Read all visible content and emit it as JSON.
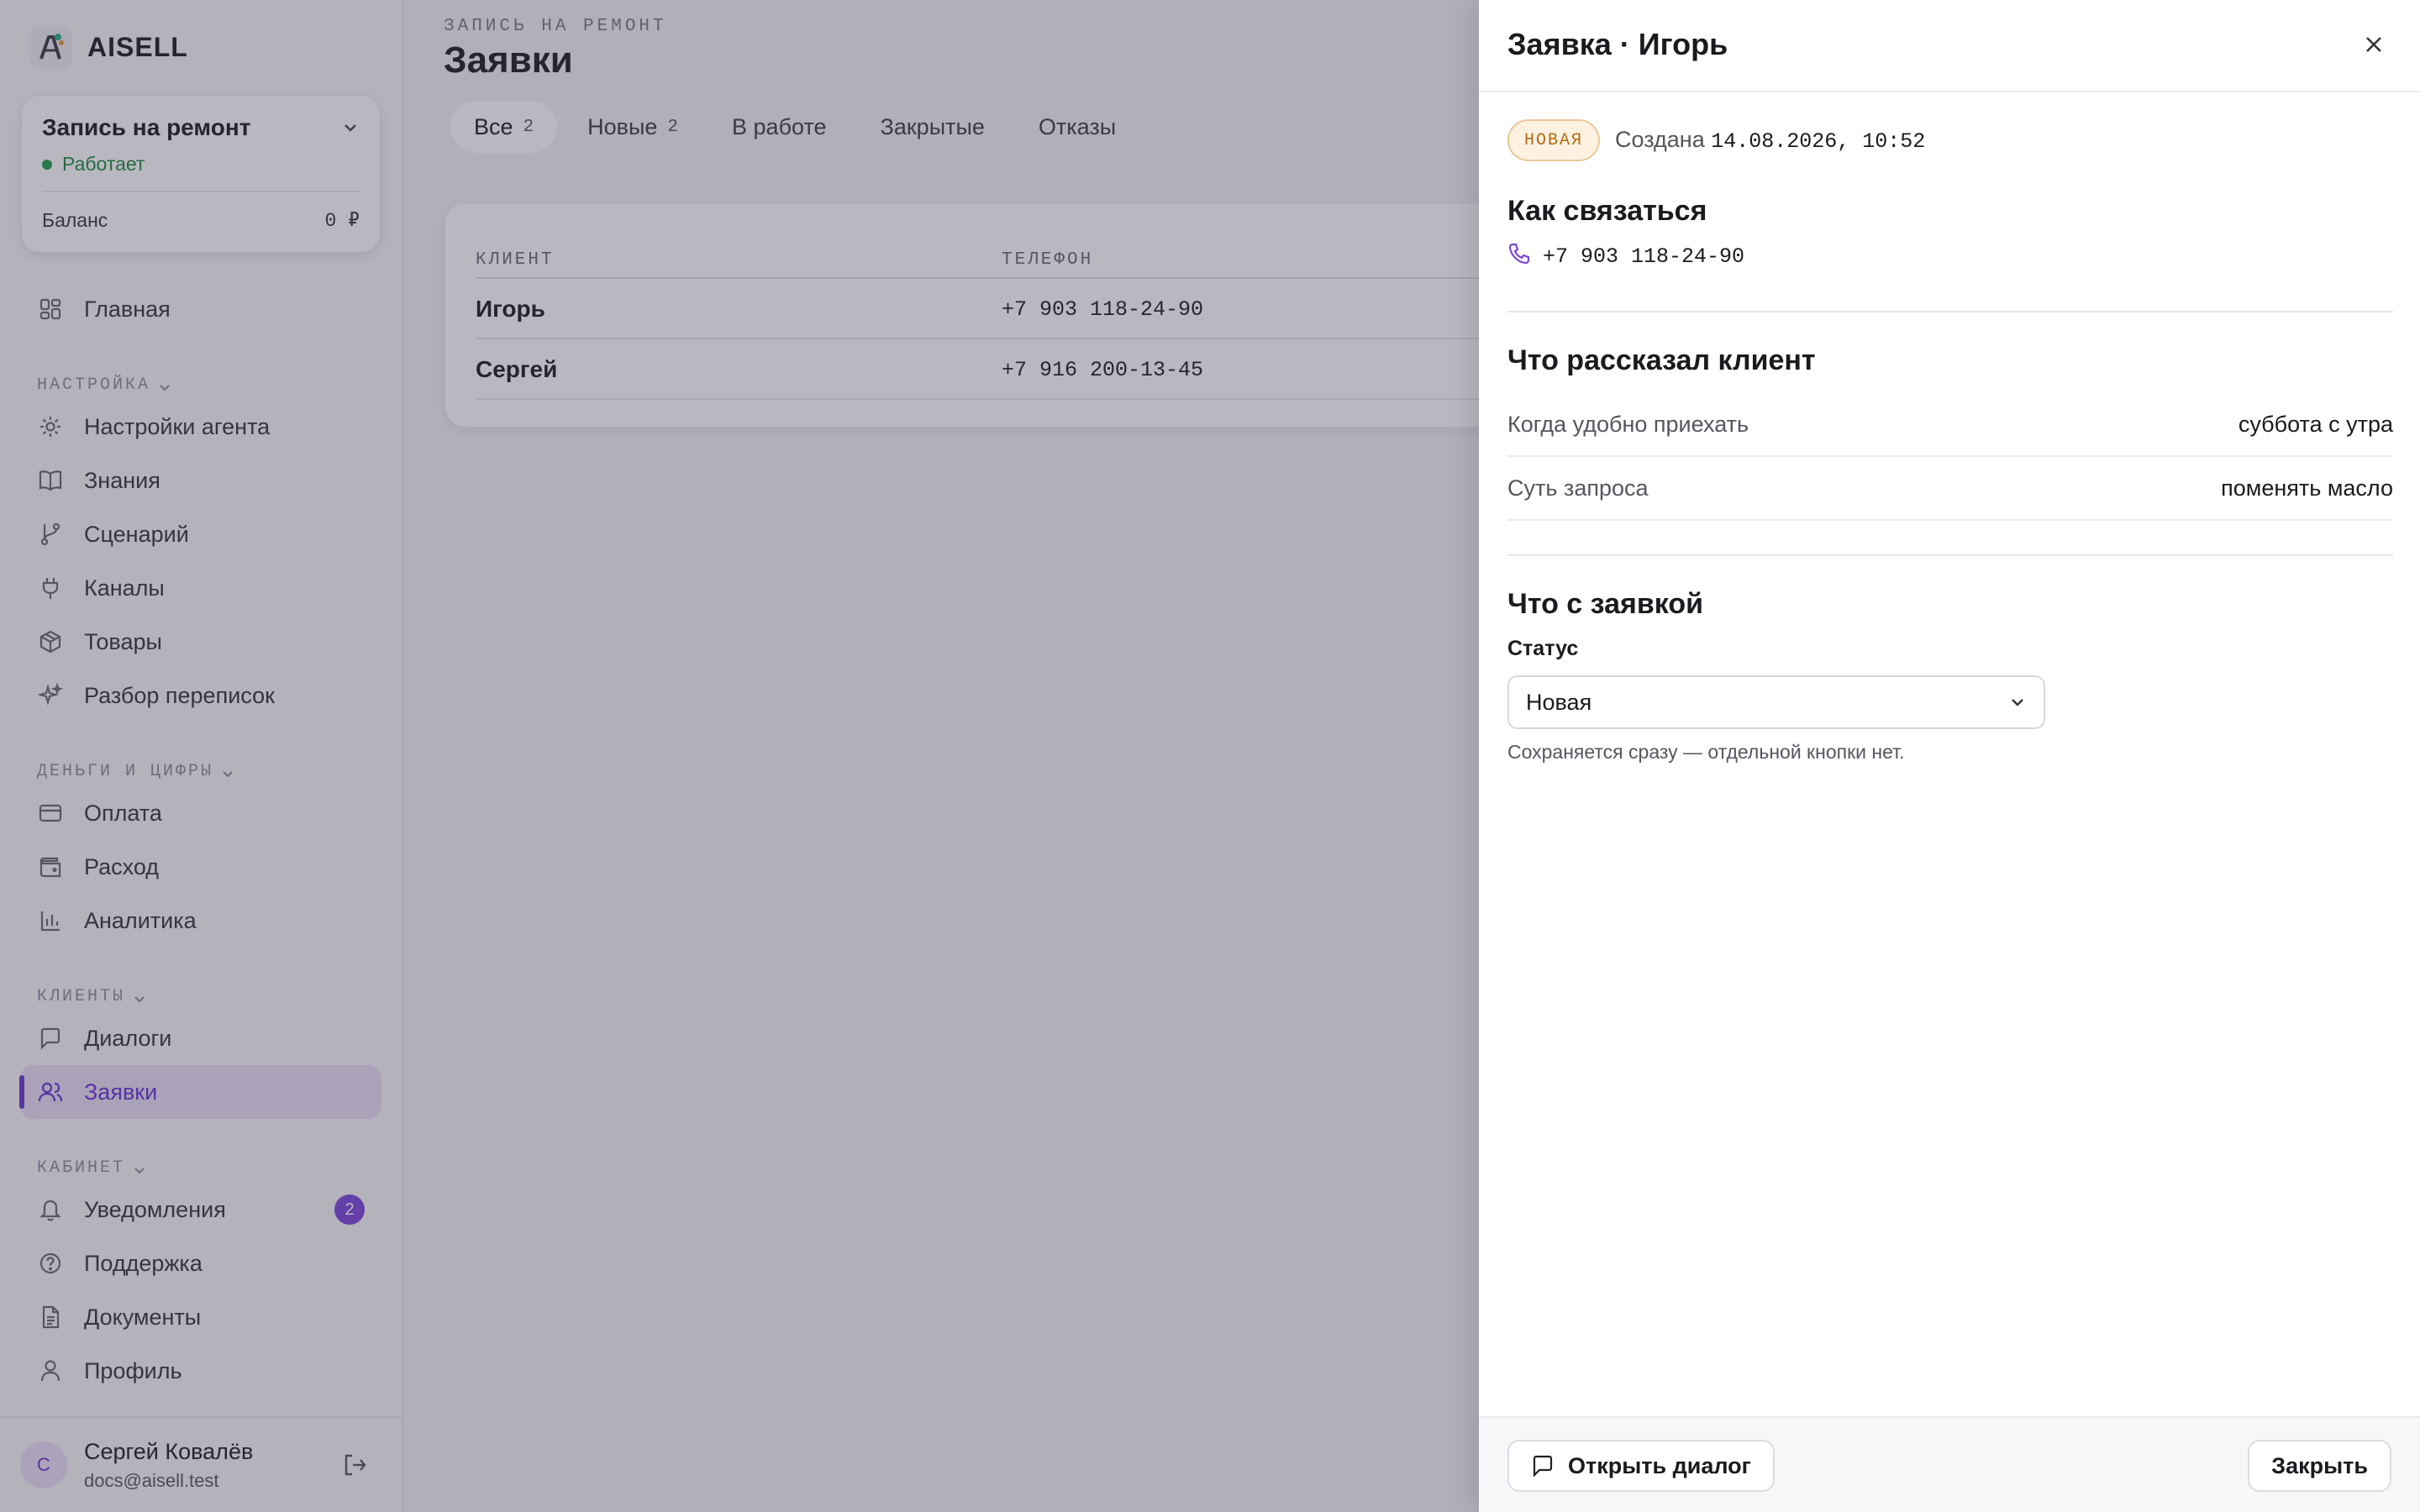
{
  "brand": {
    "name": "AISELL"
  },
  "agent": {
    "title": "Запись на ремонт",
    "status": "Работает",
    "balance_label": "Баланс",
    "balance_value": "0 ₽"
  },
  "nav": {
    "home": "Главная",
    "section_settings": "НАСТРОЙКА",
    "agent_settings": "Настройки агента",
    "knowledge": "Знания",
    "scenario": "Сценарий",
    "channels": "Каналы",
    "products": "Товары",
    "chat_review": "Разбор переписок",
    "section_money": "ДЕНЬГИ И ЦИФРЫ",
    "payment": "Оплата",
    "expense": "Расход",
    "analytics": "Аналитика",
    "section_clients": "КЛИЕНТЫ",
    "dialogs": "Диалоги",
    "requests": "Заявки",
    "section_cabinet": "КАБИНЕТ",
    "notifications": "Уведомления",
    "notifications_count": "2",
    "support": "Поддержка",
    "documents": "Документы",
    "profile": "Профиль"
  },
  "user": {
    "initial": "С",
    "name": "Сергей Ковалёв",
    "email": "docs@aisell.test"
  },
  "page": {
    "eyebrow": "ЗАПИСЬ НА РЕМОНТ",
    "title": "Заявки"
  },
  "tabs": [
    {
      "label": "Все",
      "count": "2"
    },
    {
      "label": "Новые",
      "count": "2"
    },
    {
      "label": "В работе"
    },
    {
      "label": "Закрытые"
    },
    {
      "label": "Отказы"
    }
  ],
  "table": {
    "col_client": "КЛИЕНТ",
    "col_phone": "ТЕЛЕФОН",
    "rows": [
      {
        "name": "Игорь",
        "phone": "+7 903 118-24-90"
      },
      {
        "name": "Сергей",
        "phone": "+7 916 200-13-45"
      }
    ]
  },
  "drawer": {
    "title": "Заявка · Игорь",
    "badge": "НОВАЯ",
    "created_label": "Создана",
    "created_value": "14.08.2026, 10:52",
    "contact_title": "Как связаться",
    "contact_phone": "+7 903 118-24-90",
    "told_title": "Что рассказал клиент",
    "fields": [
      {
        "key": "Когда удобно приехать",
        "value": "суббота с утра"
      },
      {
        "key": "Суть запроса",
        "value": "поменять масло"
      }
    ],
    "status_title": "Что с заявкой",
    "status_label": "Статус",
    "status_value": "Новая",
    "hint": "Сохраняется сразу — отдельной кнопки нет.",
    "open_dialog": "Открыть диалог",
    "close": "Закрыть"
  }
}
